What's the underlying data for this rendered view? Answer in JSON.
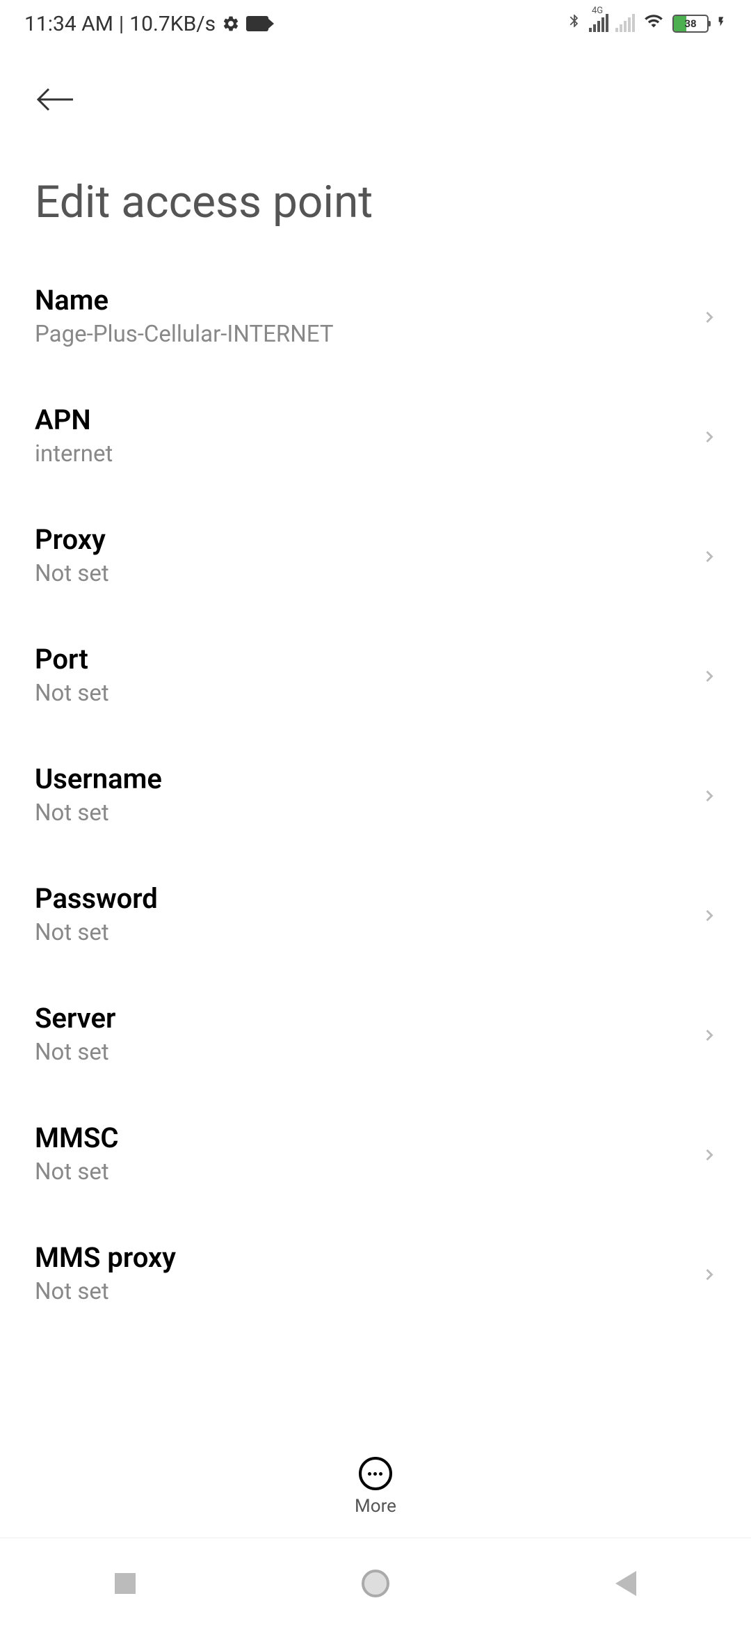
{
  "status": {
    "time": "11:34 AM",
    "separator": "|",
    "network_speed": "10.7KB/s",
    "battery_level": "38",
    "network_label": "4G"
  },
  "header": {
    "title": "Edit access point"
  },
  "items": [
    {
      "label": "Name",
      "value": "Page-Plus-Cellular-INTERNET"
    },
    {
      "label": "APN",
      "value": "internet"
    },
    {
      "label": "Proxy",
      "value": "Not set"
    },
    {
      "label": "Port",
      "value": "Not set"
    },
    {
      "label": "Username",
      "value": "Not set"
    },
    {
      "label": "Password",
      "value": "Not set"
    },
    {
      "label": "Server",
      "value": "Not set"
    },
    {
      "label": "MMSC",
      "value": "Not set"
    },
    {
      "label": "MMS proxy",
      "value": "Not set"
    }
  ],
  "toolbar": {
    "more_label": "More"
  }
}
